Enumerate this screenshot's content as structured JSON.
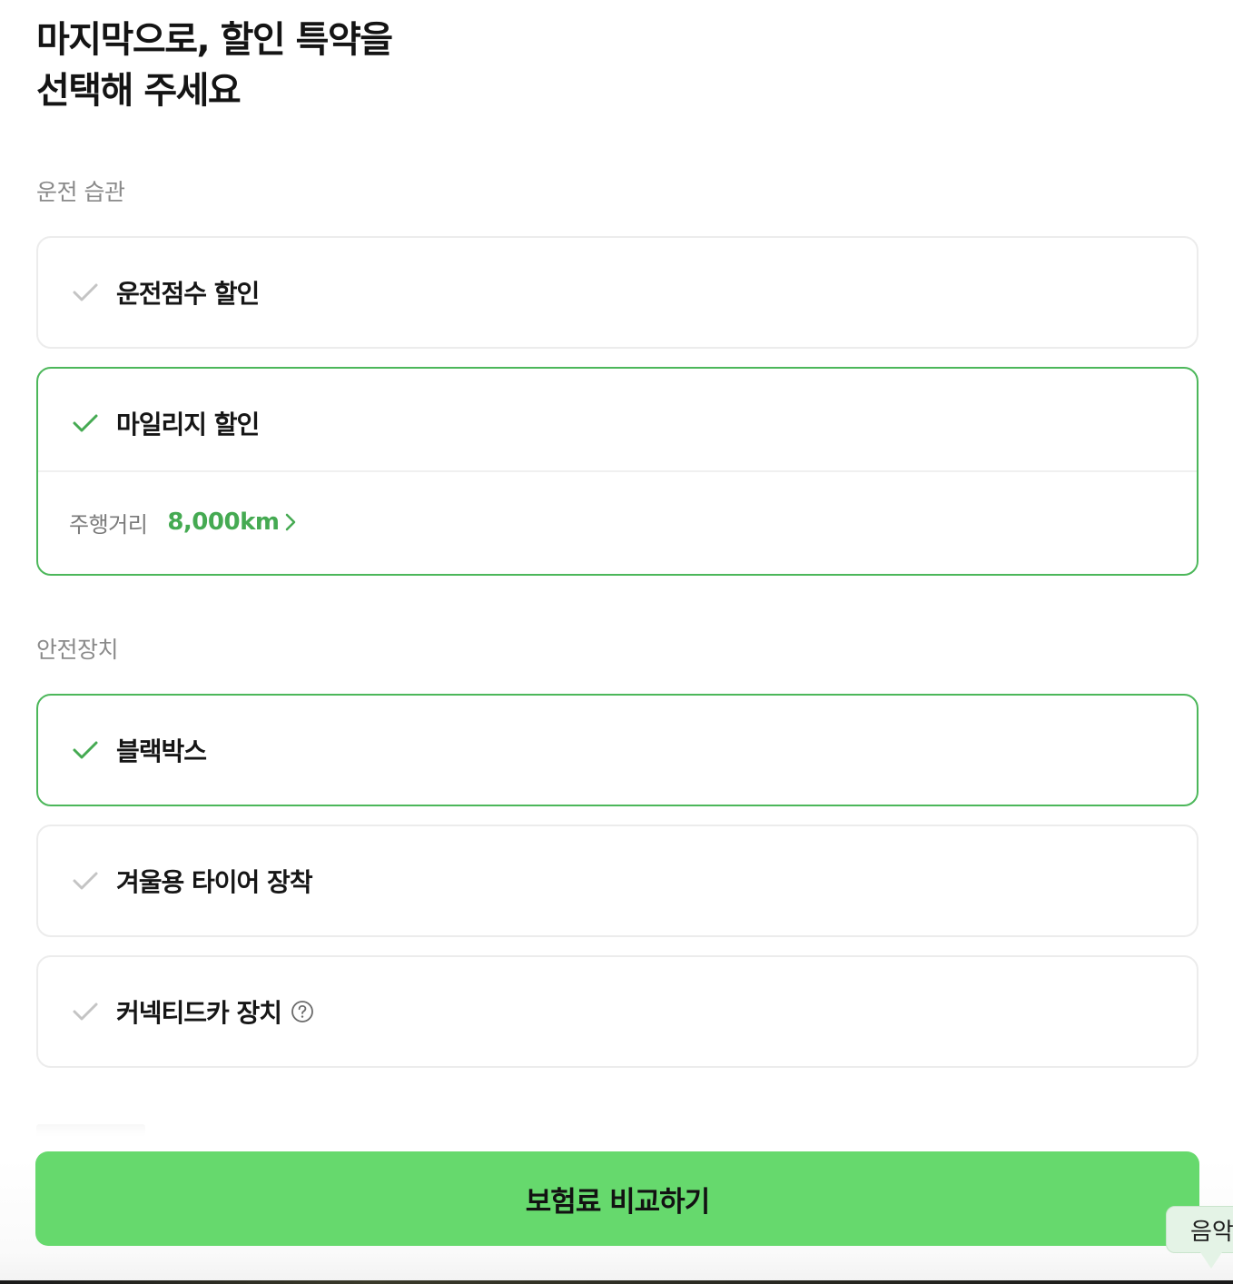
{
  "header": {
    "title_line1": "마지막으로, 할인 특약을",
    "title_line2": "선택해 주세요"
  },
  "sections": {
    "driving_habits": {
      "label": "운전 습관",
      "items": [
        {
          "label": "운전점수 할인",
          "selected": false
        },
        {
          "label": "마일리지 할인",
          "selected": true,
          "detail_label": "주행거리",
          "detail_value": "8,000km"
        }
      ]
    },
    "safety_devices": {
      "label": "안전장치",
      "items": [
        {
          "label": "블랙박스",
          "selected": true
        },
        {
          "label": "겨울용 타이어 장착",
          "selected": false
        },
        {
          "label": "커넥티드카 장치",
          "selected": false,
          "has_help": true
        }
      ]
    }
  },
  "cta": {
    "label": "보험료 비교하기"
  },
  "tooltip": {
    "text": "음악"
  },
  "colors": {
    "accent_green": "#45aa52",
    "selected_border": "#4cb75a",
    "cta_background": "#66d96d",
    "unchecked_icon": "#c4c4c4"
  },
  "icons": {
    "check_selected": "check-icon",
    "check_unselected": "check-icon",
    "chevron": "chevron-right-icon",
    "help": "question-circle-icon"
  }
}
